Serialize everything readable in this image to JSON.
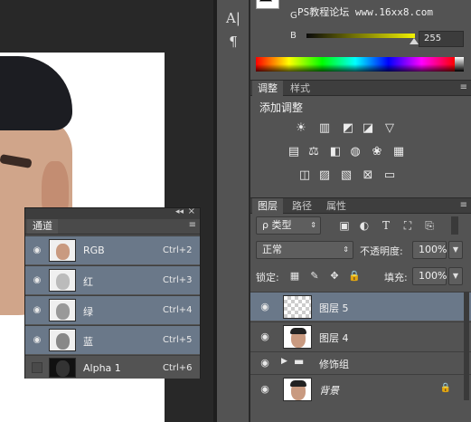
{
  "watermark": "PS教程论坛 www.16xx8.com",
  "tools": [
    {
      "icon": "type-icon",
      "glyph": "A|"
    },
    {
      "icon": "paragraph-icon",
      "glyph": "¶"
    }
  ],
  "color": {
    "g_label": "G",
    "b_label": "B",
    "b_value": "255",
    "slider_start": "#0a0a0a",
    "slider_end": "#f2f200"
  },
  "adjust": {
    "tabs": [
      "调整",
      "样式"
    ],
    "title": "添加调整",
    "menu": "≡"
  },
  "layers_panel": {
    "tabs": [
      "图层",
      "路径",
      "属性"
    ],
    "filter_label": "ρ 类型",
    "blend_mode": "正常",
    "opacity_label": "不透明度:",
    "opacity_value": "100%",
    "lock_label": "锁定:",
    "fill_label": "填充:",
    "fill_value": "100%",
    "layers": [
      {
        "name": "图层 5",
        "selected": true,
        "type": "transparent"
      },
      {
        "name": "图层 4",
        "selected": false,
        "type": "photo"
      },
      {
        "name": "修饰组",
        "selected": false,
        "type": "group"
      },
      {
        "name": "背景",
        "selected": false,
        "type": "photo",
        "locked": true
      }
    ]
  },
  "channels_panel": {
    "tab": "通道",
    "collapse": "◂◂",
    "close": "×",
    "menu": "≡",
    "channels": [
      {
        "name": "RGB",
        "shortcut": "Ctrl+2",
        "selected": true,
        "visible": true
      },
      {
        "name": "红",
        "shortcut": "Ctrl+3",
        "selected": true,
        "visible": true
      },
      {
        "name": "绿",
        "shortcut": "Ctrl+4",
        "selected": true,
        "visible": true
      },
      {
        "name": "蓝",
        "shortcut": "Ctrl+5",
        "selected": true,
        "visible": true
      },
      {
        "name": "Alpha 1",
        "shortcut": "Ctrl+6",
        "selected": false,
        "visible": false
      }
    ]
  },
  "accent": {
    "selected_row": "#6a7889",
    "panel_bg": "#535353"
  }
}
